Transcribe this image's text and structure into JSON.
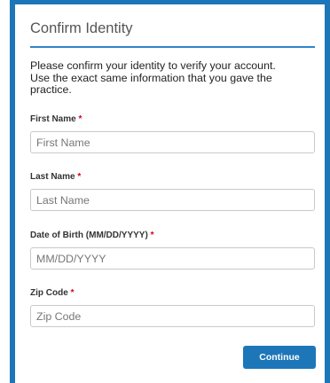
{
  "dialog": {
    "title": "Confirm Identity",
    "intro_line1": "Please confirm your identity to verify your account.",
    "intro_line2": "Use the exact same information that you gave the",
    "intro_line3": "practice."
  },
  "form": {
    "required_marker": "*",
    "fields": [
      {
        "label": "First Name",
        "placeholder": "First Name",
        "value": ""
      },
      {
        "label": "Last Name",
        "placeholder": "Last Name",
        "value": ""
      },
      {
        "label": "Date of Birth (MM/DD/YYYY)",
        "placeholder": "MM/DD/YYYY",
        "value": ""
      },
      {
        "label": "Zip Code",
        "placeholder": "Zip Code",
        "value": ""
      }
    ]
  },
  "actions": {
    "continue_label": "Continue"
  },
  "colors": {
    "accent": "#1d76b8",
    "required": "#d0021b"
  }
}
